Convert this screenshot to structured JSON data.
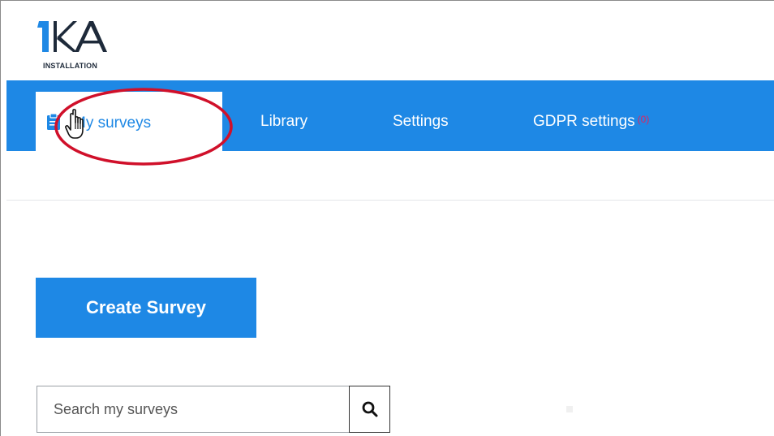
{
  "logo": {
    "mark": "1KA",
    "subtitle": "INSTALLATION",
    "color": "#1e88e5",
    "ink": "#1e2a3a"
  },
  "nav": {
    "color": "#1e88e5",
    "tabs": [
      {
        "label": "My surveys",
        "active": true,
        "icon": "clipboard-icon"
      },
      {
        "label": "Library",
        "active": false
      },
      {
        "label": "Settings",
        "active": false
      },
      {
        "label": "GDPR settings",
        "active": false,
        "badge": "(0)"
      }
    ]
  },
  "annotation": {
    "highlight_color": "#d0102a"
  },
  "actions": {
    "create_label": "Create Survey"
  },
  "search": {
    "placeholder": "Search my surveys",
    "value": "",
    "icon": "search-icon"
  }
}
